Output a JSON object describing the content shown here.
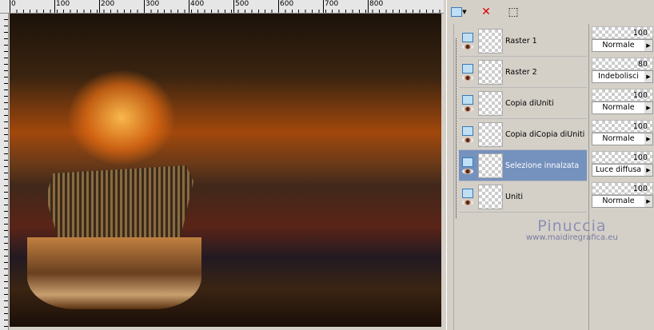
{
  "ruler": {
    "labels": [
      "0",
      "100",
      "200",
      "300",
      "400",
      "500",
      "600",
      "700",
      "800"
    ]
  },
  "toolbar": {
    "icons": [
      "new-layer-icon",
      "delete-layer-icon",
      "edit-selection-icon"
    ]
  },
  "layers": [
    {
      "name": "Raster 1",
      "opacity": "100",
      "blend": "Normale",
      "selected": false
    },
    {
      "name": "Raster 2",
      "opacity": "80",
      "blend": "Indebolisci",
      "selected": false
    },
    {
      "name": "Copia diUniti",
      "opacity": "100",
      "blend": "Normale",
      "selected": false
    },
    {
      "name": "Copia diCopia diUniti",
      "opacity": "100",
      "blend": "Normale",
      "selected": false
    },
    {
      "name": "Selezione innalzata",
      "opacity": "100",
      "blend": "Luce diffusa",
      "selected": true
    },
    {
      "name": "Uniti",
      "opacity": "100",
      "blend": "Normale",
      "selected": false
    }
  ],
  "watermark": {
    "name": "Pinuccia",
    "url": "www.maidiregrafica.eu"
  }
}
